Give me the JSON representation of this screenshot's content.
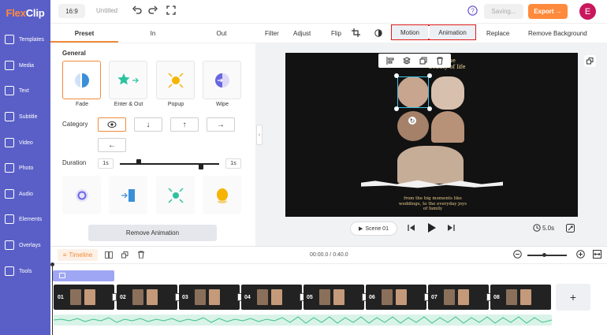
{
  "app": {
    "logo_flex": "Flex",
    "logo_clip": "Clip",
    "aspect": "16:9",
    "doc_title": "Untitled",
    "save_status": "Saving...",
    "export_label": "Export →",
    "avatar_letter": "E"
  },
  "sidebar": {
    "items": [
      {
        "label": "Templates",
        "icon": "templates-icon"
      },
      {
        "label": "Media",
        "icon": "media-icon"
      },
      {
        "label": "Text",
        "icon": "text-icon"
      },
      {
        "label": "Subtitle",
        "icon": "subtitle-icon"
      },
      {
        "label": "Video",
        "icon": "video-icon"
      },
      {
        "label": "Photo",
        "icon": "photo-icon"
      },
      {
        "label": "Audio",
        "icon": "audio-icon"
      },
      {
        "label": "Elements",
        "icon": "elements-icon"
      },
      {
        "label": "Overlays",
        "icon": "overlays-icon"
      },
      {
        "label": "Tools",
        "icon": "tools-icon"
      }
    ]
  },
  "panel": {
    "tabs": [
      "Preset",
      "In",
      "Out"
    ],
    "general_label": "General",
    "presets": [
      "Fade",
      "Enter & Out",
      "Popup",
      "Wipe"
    ],
    "category_label": "Category",
    "duration_label": "Duration",
    "duration_start": "1s",
    "duration_end": "1s",
    "remove_label": "Remove Animation"
  },
  "toolbar": {
    "filter": "Filter",
    "adjust": "Adjust",
    "flip": "Flip",
    "motion": "Motion",
    "animation": "Animation",
    "replace": "Replace",
    "remove_bg": "Remove Background"
  },
  "canvas": {
    "top_text_line1": "re the",
    "top_text_line2": "beauty of life",
    "bottom_text_line1": "from the big moments like",
    "bottom_text_line2": "weddings, to the everyday joys",
    "bottom_text_line3": "of family"
  },
  "player": {
    "scene": "Scene 01",
    "duration": "5.0s"
  },
  "timeline": {
    "label": "Timeline",
    "time": "00:00.0 / 0:40.0",
    "clips": [
      "01",
      "02",
      "03",
      "04",
      "05",
      "06",
      "07",
      "08"
    ],
    "add": "+"
  },
  "colors": {
    "sidebar": "#5a5fc7",
    "accent": "#f08a3a",
    "export": "#ff8a3c",
    "avatar": "#c8175d",
    "highlight": "#e01b1b",
    "audio": "#3ec18a"
  }
}
